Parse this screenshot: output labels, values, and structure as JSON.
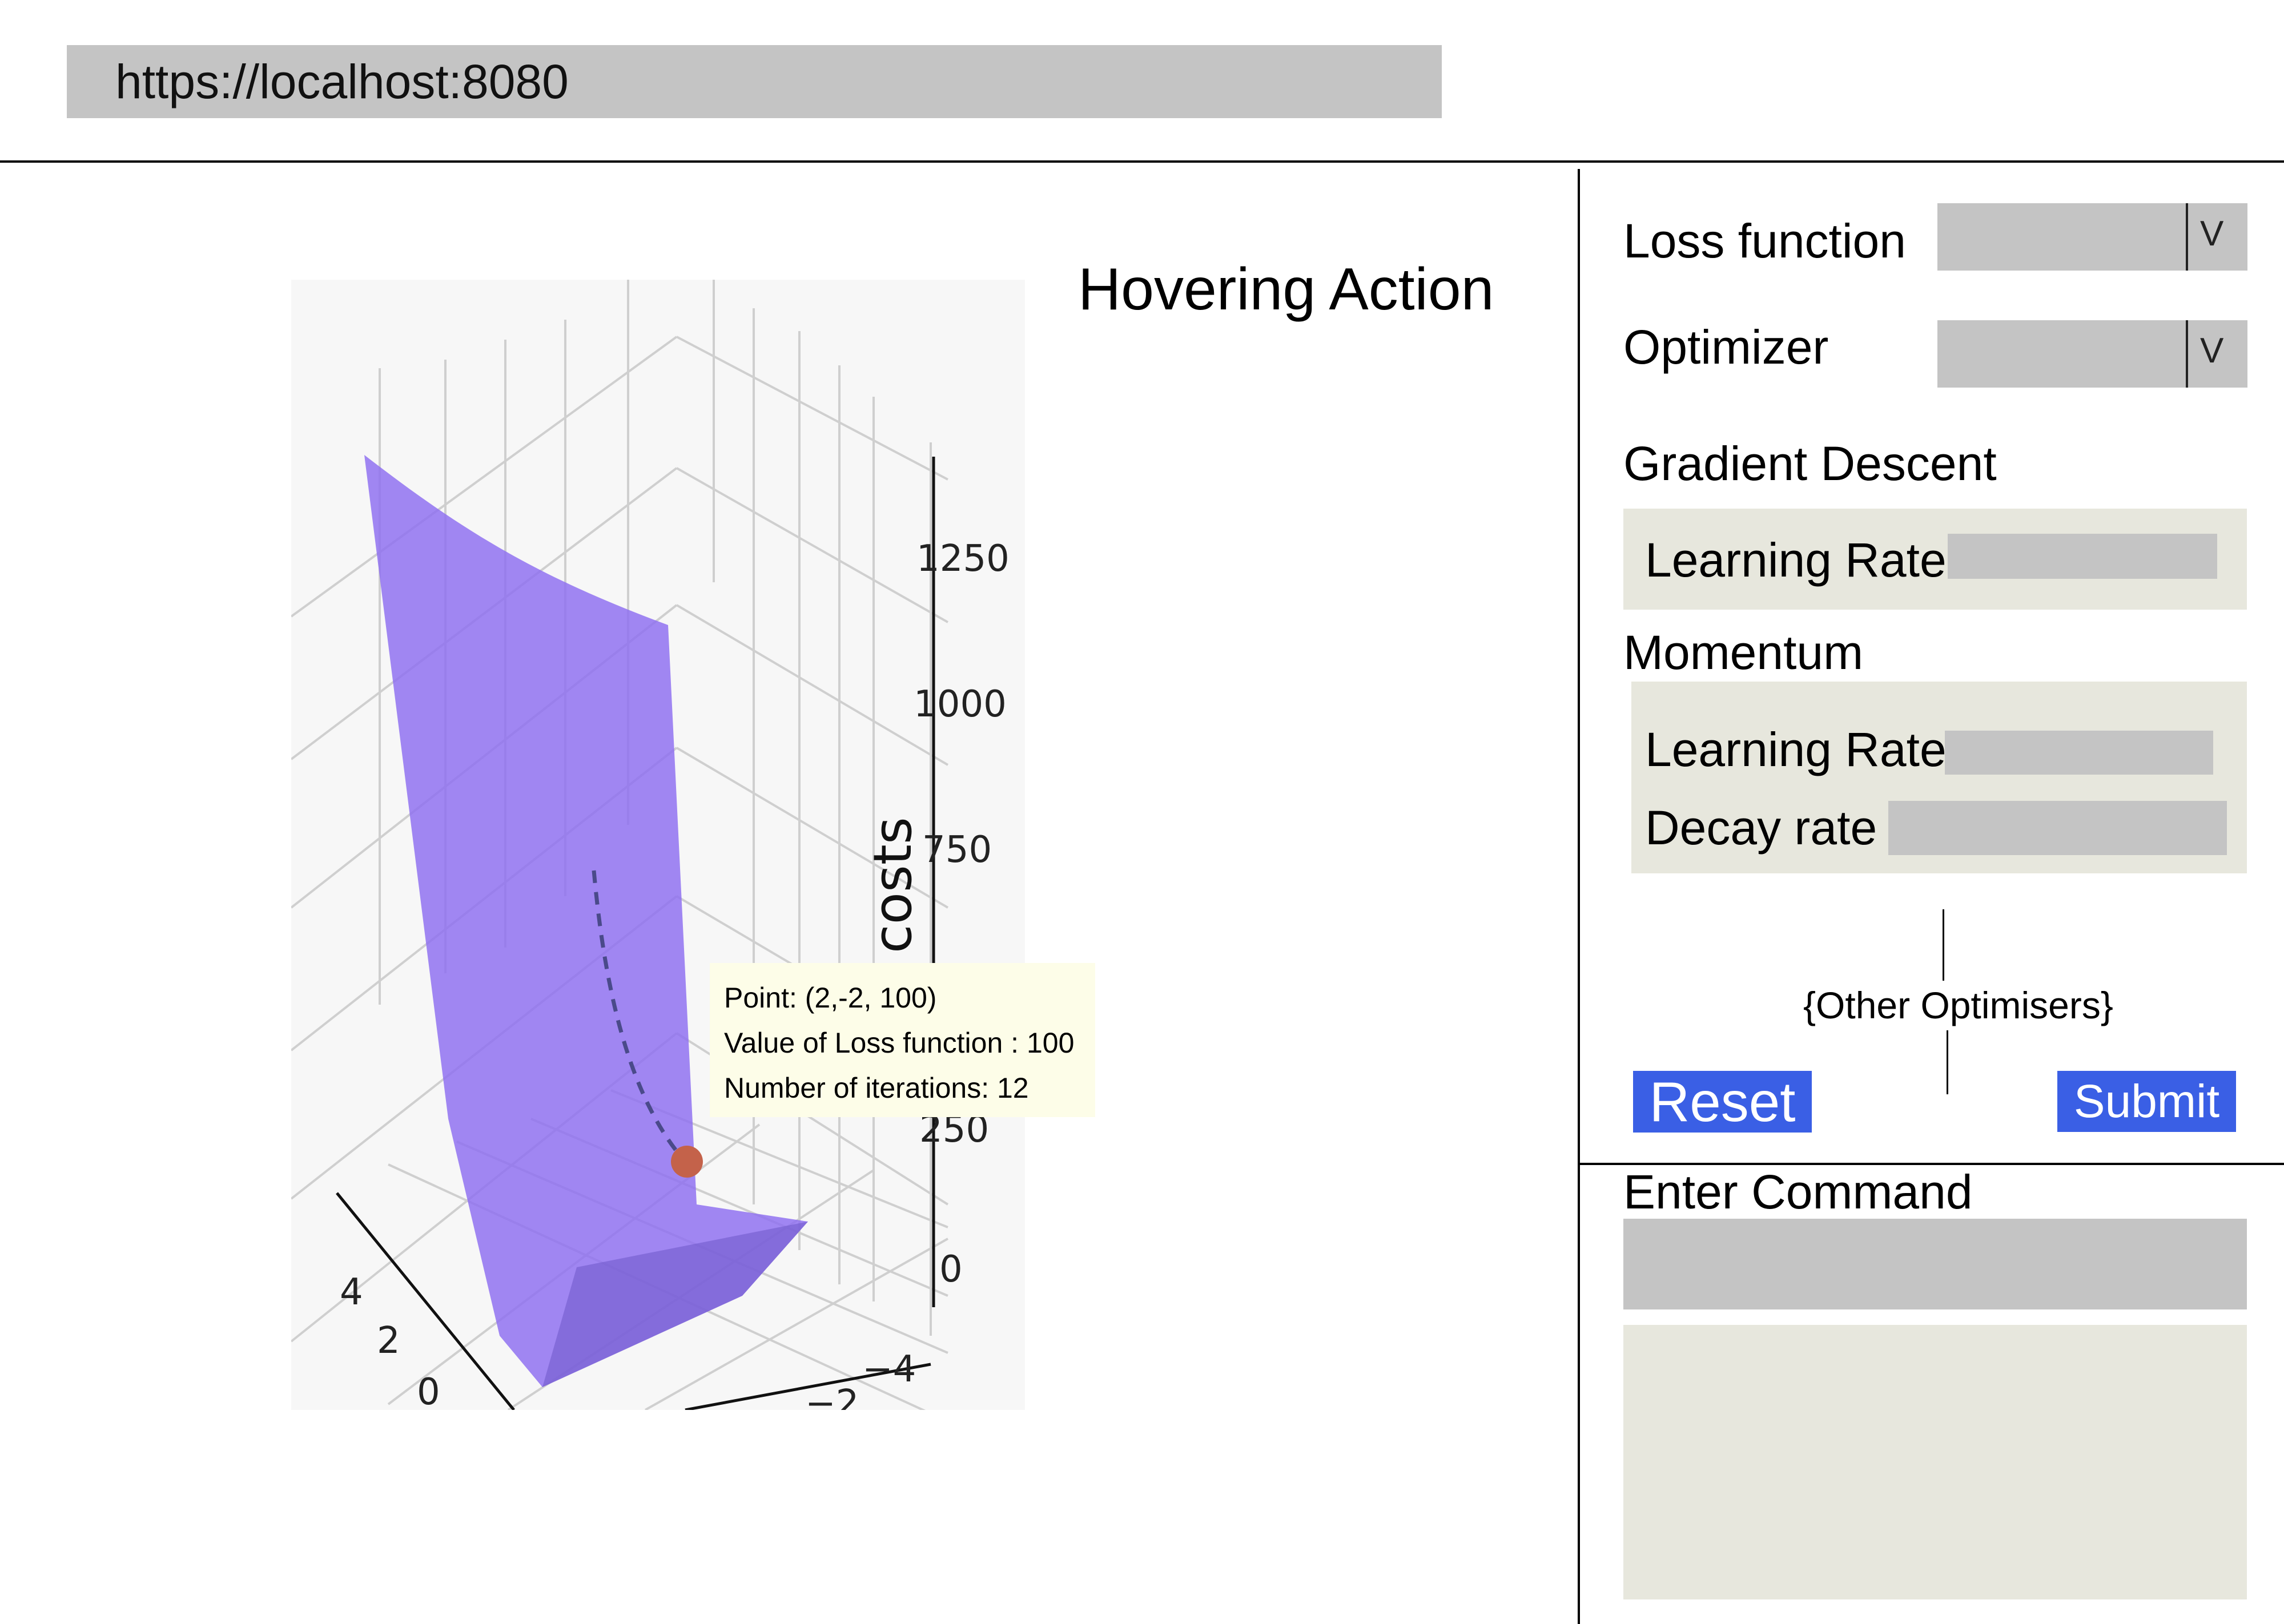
{
  "browser": {
    "url": "https://localhost:8080"
  },
  "plot": {
    "title": "Hovering Action",
    "zlabel": "costs",
    "z_ticks": [
      "1250",
      "1000",
      "750",
      "250",
      "0"
    ],
    "x_ticks": [
      "4",
      "2",
      "0"
    ],
    "y_ticks": [
      "−4",
      "−2"
    ],
    "tooltip": {
      "point": "Point: (2,-2, 100)",
      "loss": "Value of Loss function : 100",
      "iterations": "Number of iterations: 12"
    },
    "colors": {
      "surface": "#8c6df0",
      "marker": "#c4624a",
      "path": "#4a4a8a"
    }
  },
  "panel": {
    "loss_function_label": "Loss function",
    "optimizer_label": "Optimizer",
    "select_chevron": "V",
    "gradient_descent": {
      "title": "Gradient Descent",
      "learning_rate_label": "Learning Rate"
    },
    "momentum": {
      "title": "Momentum",
      "learning_rate_label": "Learning Rate",
      "decay_rate_label": "Decay rate"
    },
    "other_optimisers": "{Other Optimisers}",
    "reset_label": "Reset",
    "submit_label": "Submit",
    "command_label": "Enter Command",
    "colors": {
      "button": "#3a5fe5",
      "input": "#c4c4c4",
      "box": "#e7e7dd"
    }
  }
}
